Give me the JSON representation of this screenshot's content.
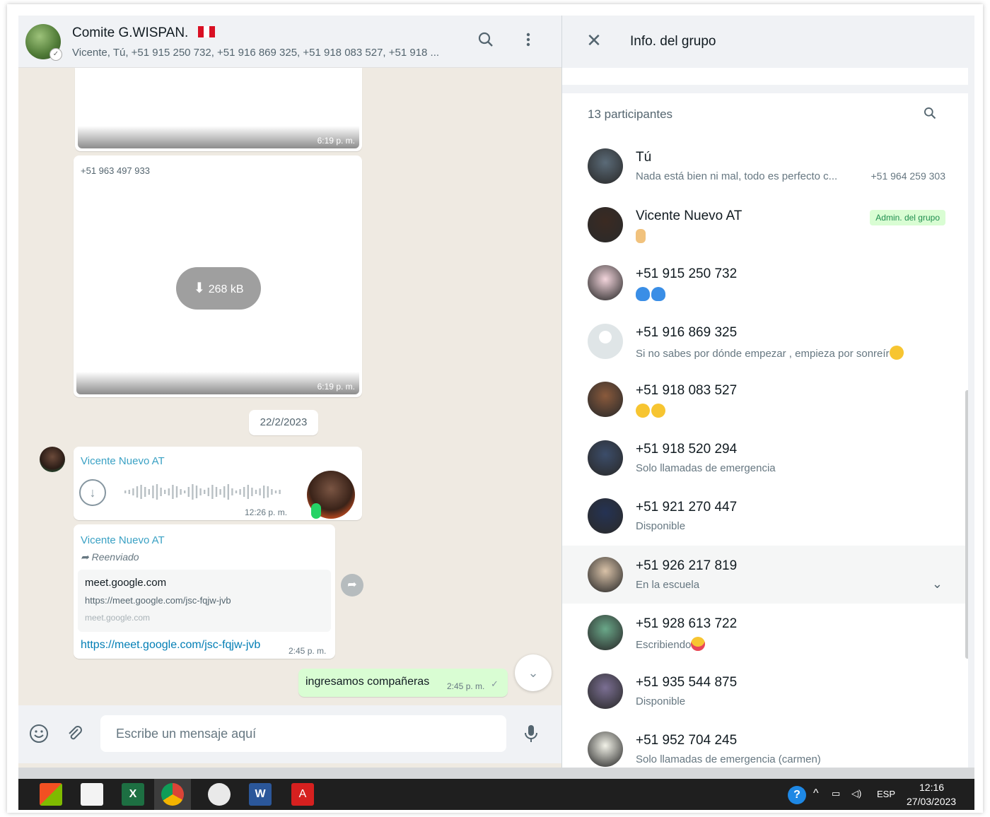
{
  "chat": {
    "title": "Comite G.WISPAN.",
    "subtitle": "Vicente, Tú, +51 915 250 732, +51 916 869 325, +51 918 083 527, +51 918 ...",
    "icons": {
      "search": "search-icon",
      "menu": "kebab-menu-icon"
    },
    "messages": {
      "img1_time": "6:19 p. m.",
      "img2_sender": "+51 963 497 933",
      "img2_size": "268 kB",
      "img2_time": "6:19 p. m.",
      "date_chip": "22/2/2023",
      "voice_sender": "Vicente Nuevo AT",
      "voice_time": "12:26 p. m.",
      "link_sender": "Vicente Nuevo AT",
      "link_forwarded": "Reenviado",
      "link_card_title": "meet.google.com",
      "link_card_url": "https://meet.google.com/jsc-fqjw-jvb",
      "link_card_domain": "meet.google.com",
      "link_text": "https://meet.google.com/jsc-fqjw-jvb",
      "link_time": "2:45 p. m.",
      "out_text": "ingresamos compañeras",
      "out_time": "2:45 p. m."
    },
    "composer": {
      "placeholder": "Escribe un mensaje aquí"
    }
  },
  "info": {
    "title": "Info. del grupo",
    "participants_count": "13 participantes",
    "members": [
      {
        "name": "Tú",
        "status": "Nada está bien ni mal, todo es perfecto c...",
        "phone": "+51 964 259 303"
      },
      {
        "name": "Vicente Nuevo AT",
        "status": "",
        "badge": "Admin. del grupo",
        "emoji": [
          "pray"
        ]
      },
      {
        "name": "+51 915 250 732",
        "status": "",
        "emoji": [
          "heart",
          "heart"
        ]
      },
      {
        "name": "+51 916 869 325",
        "status": "Si no sabes por dónde empezar , empieza por sonreír",
        "emoji_end": [
          "yellow"
        ]
      },
      {
        "name": "+51 918 083 527",
        "status": "",
        "emoji": [
          "yellow",
          "yellow"
        ]
      },
      {
        "name": "+51 918 520 294",
        "status": "Solo llamadas de emergencia"
      },
      {
        "name": "+51 921 270 447",
        "status": "Disponible"
      },
      {
        "name": "+51 926 217 819",
        "status": "En la escuela",
        "hover": true
      },
      {
        "name": "+51 928 613 722",
        "status": "Escribiendo",
        "emoji_end": [
          "red"
        ]
      },
      {
        "name": "+51 935 544 875",
        "status": "Disponible"
      },
      {
        "name": "+51 952 704 245",
        "status": "Solo llamadas de emergencia (carmen)"
      }
    ]
  },
  "taskbar": {
    "lang": "ESP",
    "time": "12:16",
    "date": "27/03/2023",
    "apps": [
      "store-icon",
      "mail-icon",
      "excel-icon",
      "chrome-icon",
      "paint-icon",
      "word-icon",
      "acrobat-icon"
    ]
  },
  "colors": {
    "accent": "#25d366",
    "outgoing_bubble": "#d9fdd3",
    "sender_name": "#3aa1c4",
    "chat_bg": "#efeae2"
  }
}
